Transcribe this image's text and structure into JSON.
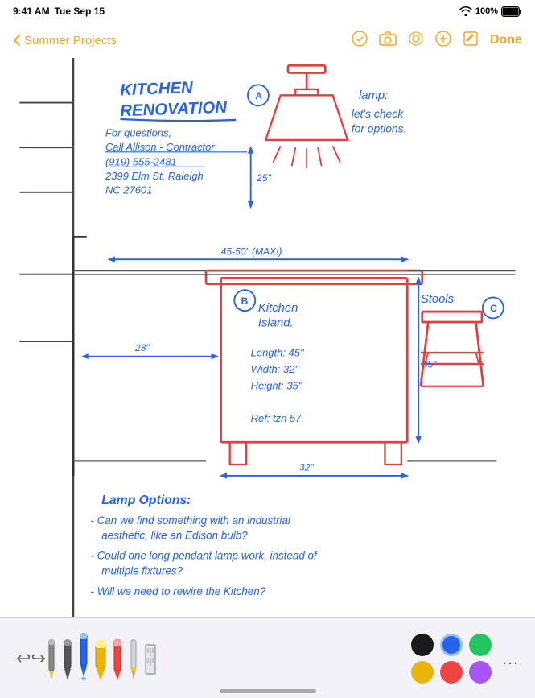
{
  "statusBar": {
    "time": "9:41 AM",
    "day": "Tue Sep 15",
    "wifi": "WiFi",
    "battery": "100%"
  },
  "nav": {
    "back_label": "Summer Projects",
    "done_label": "Done",
    "tools": [
      "checkmark-icon",
      "camera-icon",
      "lasso-icon",
      "plus-icon",
      "edit-icon"
    ]
  },
  "note": {
    "title": "KITCHEN RENOVATION",
    "contact_header": "For questions,",
    "contact_line1": "Call Allison - Contractor",
    "contact_phone": "(919) 555-2481",
    "contact_addr1": "2399 Elm St, Raleigh",
    "contact_addr2": "NC 27601",
    "lamp_label": "lamp:",
    "lamp_note": "let's check for options.",
    "island_label": "Kitchen Island.",
    "island_length": "Length: 45\"",
    "island_width": "Width: 32\"",
    "island_height": "Height: 35\"",
    "island_ref": "Ref: tzn 57.",
    "stools_label": "Stools",
    "dim_25": "25\"",
    "dim_45_50": "45-50\" (MAX!)",
    "dim_28": "28\"",
    "dim_35": "35\"",
    "dim_32": "32\"",
    "lamp_options_header": "Lamp Options:",
    "bullet1": "- Can we find something with an industrial aesthetic, like an Edison bulb?",
    "bullet2": "- Could one long pendant lamp work, instead of multiple fixtures?",
    "bullet3": "- Will we need to rewire the Kitchen?"
  },
  "toolbar": {
    "undo_label": "↩",
    "redo_label": "↪",
    "colors_top": [
      "#1a1a1a",
      "#2563eb",
      "#22c55e"
    ],
    "colors_bottom": [
      "#eab308",
      "#ef4444",
      "#a855f7"
    ],
    "more_label": "…"
  }
}
